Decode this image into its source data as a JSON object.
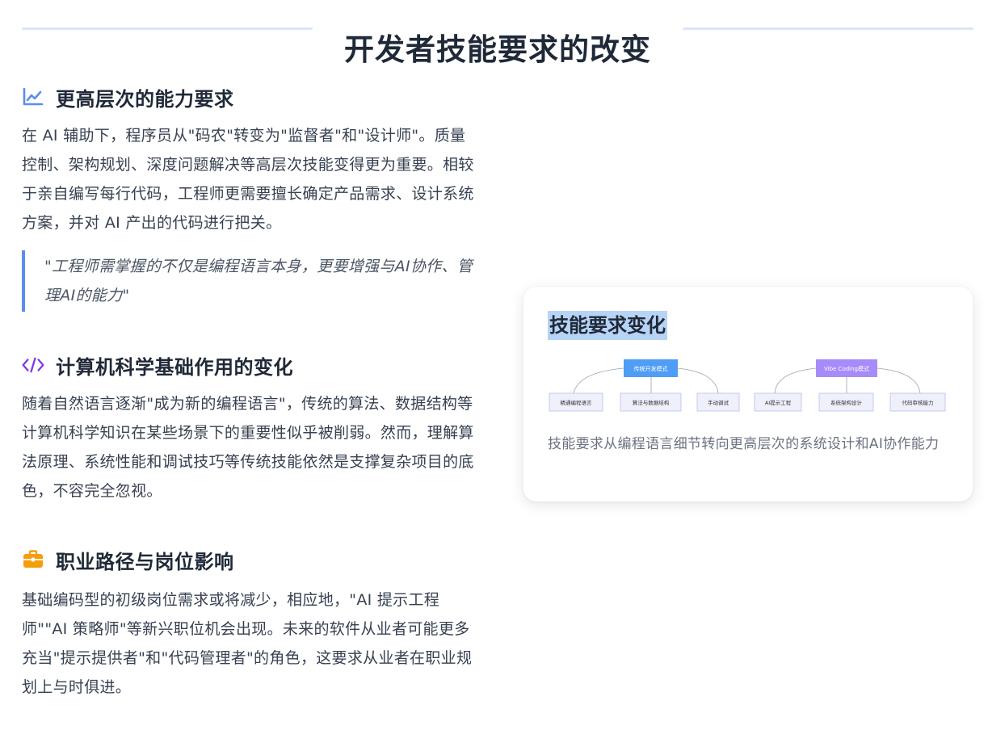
{
  "title": "开发者技能要求的改变",
  "sections": [
    {
      "icon": "chart-line-icon",
      "heading": "更高层次的能力要求",
      "paragraph": "在 AI 辅助下，程序员从\"码农\"转变为\"监督者\"和\"设计师\"。质量控制、架构规划、深度问题解决等高层次技能变得更为重要。相较于亲自编写每行代码，工程师更需要擅长确定产品需求、设计系统方案，并对 AI 产出的代码进行把关。",
      "quote": "\"工程师需掌握的不仅是编程语言本身，更要增强与AI协作、管理AI的能力\""
    },
    {
      "icon": "code-icon",
      "heading": "计算机科学基础作用的变化",
      "paragraph": "随着自然语言逐渐\"成为新的编程语言\"，传统的算法、数据结构等计算机科学知识在某些场景下的重要性似乎被削弱。然而，理解算法原理、系统性能和调试技巧等传统技能依然是支撑复杂项目的底色，不容完全忽视。"
    },
    {
      "icon": "briefcase-icon",
      "heading": "职业路径与岗位影响",
      "paragraph": "基础编码型的初级岗位需求或将减少，相应地，\"AI 提示工程师\"\"AI 策略师\"等新兴职位机会出现。未来的软件从业者可能更多充当\"提示提供者\"和\"代码管理者\"的角色，这要求从业者在职业规划上与时俱进。"
    }
  ],
  "card": {
    "title": "技能要求变化",
    "caption": "技能要求从编程语言细节转向更高层次的系统设计和AI协作能力",
    "diagram": {
      "left_root": "传统开发模式",
      "left_children": [
        "精通编程语言",
        "算法与数据结构",
        "手动调试"
      ],
      "right_root": "Vibe Coding模式",
      "right_children": [
        "AI提示工程",
        "系统架构设计",
        "代码审核能力"
      ]
    }
  },
  "colors": {
    "accent_blue": "#5b8def",
    "code_purple": "#7c3aed",
    "briefcase_orange": "#f59e0b",
    "left_root_fill": "#4f9df6",
    "right_root_fill": "#a78bfa",
    "child_fill": "#eef0fb",
    "child_stroke": "#b9bde8"
  }
}
